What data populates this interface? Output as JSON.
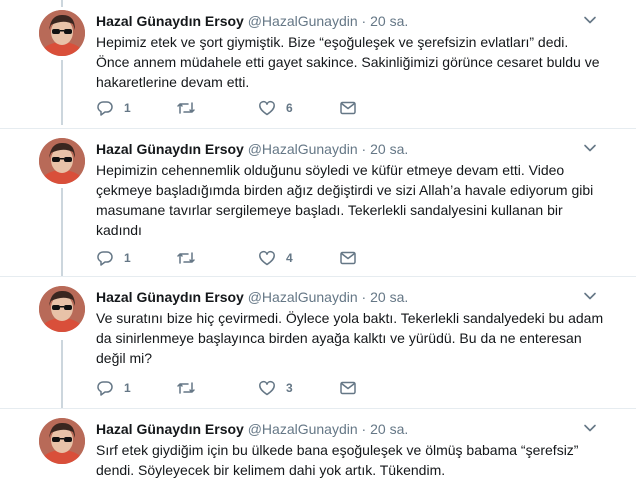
{
  "tweets": [
    {
      "name": "Hazal Günaydın Ersoy",
      "handle": "@HazalGunaydin",
      "separator": "·",
      "time": "20 sa.",
      "text": "Hepimiz etek ve şort giymiştik. Bize “eşoğuleşek ve şerefsizin evlatları” dedi. Önce annem müdahele etti gayet sakince. Sakinliğimizi görünce cesaret buldu ve hakaretlerine devam etti.",
      "replies": "1",
      "retweets": "",
      "likes": "6"
    },
    {
      "name": "Hazal Günaydın Ersoy",
      "handle": "@HazalGunaydin",
      "separator": "·",
      "time": "20 sa.",
      "text": "Hepimizin cehennemlik olduğunu söyledi ve küfür etmeye devam etti. Video çekmeye başladığımda birden ağız değiştirdi ve sizi Allah’a havale ediyorum gibi masumane tavırlar sergilemeye başladı. Tekerlekli sandalyesini kullanan bir kadındı",
      "replies": "1",
      "retweets": "",
      "likes": "4"
    },
    {
      "name": "Hazal Günaydın Ersoy",
      "handle": "@HazalGunaydin",
      "separator": "·",
      "time": "20 sa.",
      "text": "Ve suratını bize hiç çevirmedi. Öylece yola baktı. Tekerlekli sandalyedeki bu adam da sinirlenmeye başlayınca birden ayağa kalktı ve yürüdü. Bu da ne enteresan değil mi?",
      "replies": "1",
      "retweets": "",
      "likes": "3"
    },
    {
      "name": "Hazal Günaydın Ersoy",
      "handle": "@HazalGunaydin",
      "separator": "·",
      "time": "20 sa.",
      "text": "Sırf etek giydiğim için bu ülkede bana eşoğuleşek ve ölmüş babama “şerefsiz” dendi. Söyleyecek bir kelimem dahi yok artık. Tükendim."
    }
  ],
  "colors": {
    "text": "#14171a",
    "muted": "#657786",
    "divider": "#e6ecf0",
    "thread_line": "#ccd6dd"
  },
  "icons": [
    "reply-icon",
    "retweet-icon",
    "like-icon",
    "direct-message-icon",
    "caret-down-icon"
  ]
}
